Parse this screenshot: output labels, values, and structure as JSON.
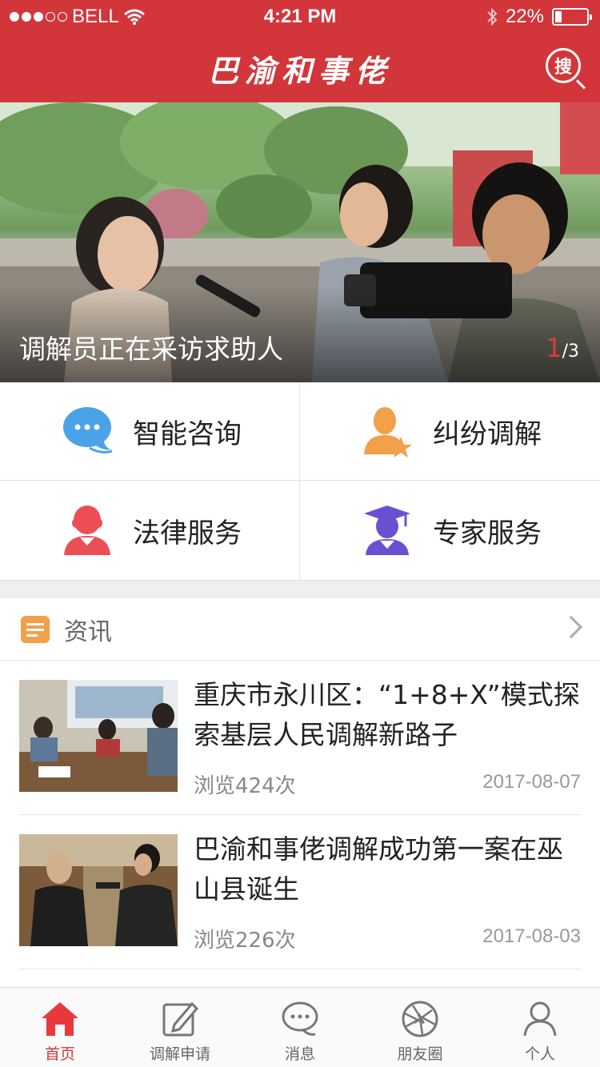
{
  "status": {
    "carrier": "BELL",
    "time": "4:21 PM",
    "battery": "22%",
    "battery_level": 0.22,
    "signal_bars": 3
  },
  "header": {
    "title": "巴渝和事佬",
    "search_label": "搜"
  },
  "banner": {
    "caption": "调解员正在采访求助人",
    "page_current": "1",
    "page_total": "/3"
  },
  "services": [
    {
      "label": "智能咨询",
      "icon": "chat-bubble-icon",
      "color": "#4aa3e8"
    },
    {
      "label": "纠纷调解",
      "icon": "person-star-icon",
      "color": "#f2a04a"
    },
    {
      "label": "法律服务",
      "icon": "judge-icon",
      "color": "#ec4e55"
    },
    {
      "label": "专家服务",
      "icon": "graduate-icon",
      "color": "#6b4fd3"
    }
  ],
  "news": {
    "section_title": "资讯",
    "items": [
      {
        "title": "重庆市永川区：“1+8+X”模式探索基层人民调解新路子",
        "views": "浏览424次",
        "date": "2017-08-07"
      },
      {
        "title": "巴渝和事佬调解成功第一案在巫山县诞生",
        "views": "浏览226次",
        "date": "2017-08-03"
      }
    ]
  },
  "tabs": [
    {
      "label": "首页",
      "icon": "home-icon",
      "active": true
    },
    {
      "label": "调解申请",
      "icon": "edit-icon",
      "active": false
    },
    {
      "label": "消息",
      "icon": "message-icon",
      "active": false
    },
    {
      "label": "朋友圈",
      "icon": "aperture-icon",
      "active": false
    },
    {
      "label": "个人",
      "icon": "person-icon",
      "active": false
    }
  ],
  "colors": {
    "brand": "#d2363a",
    "divider": "#e3e3e3",
    "background_gap": "#efefef"
  }
}
